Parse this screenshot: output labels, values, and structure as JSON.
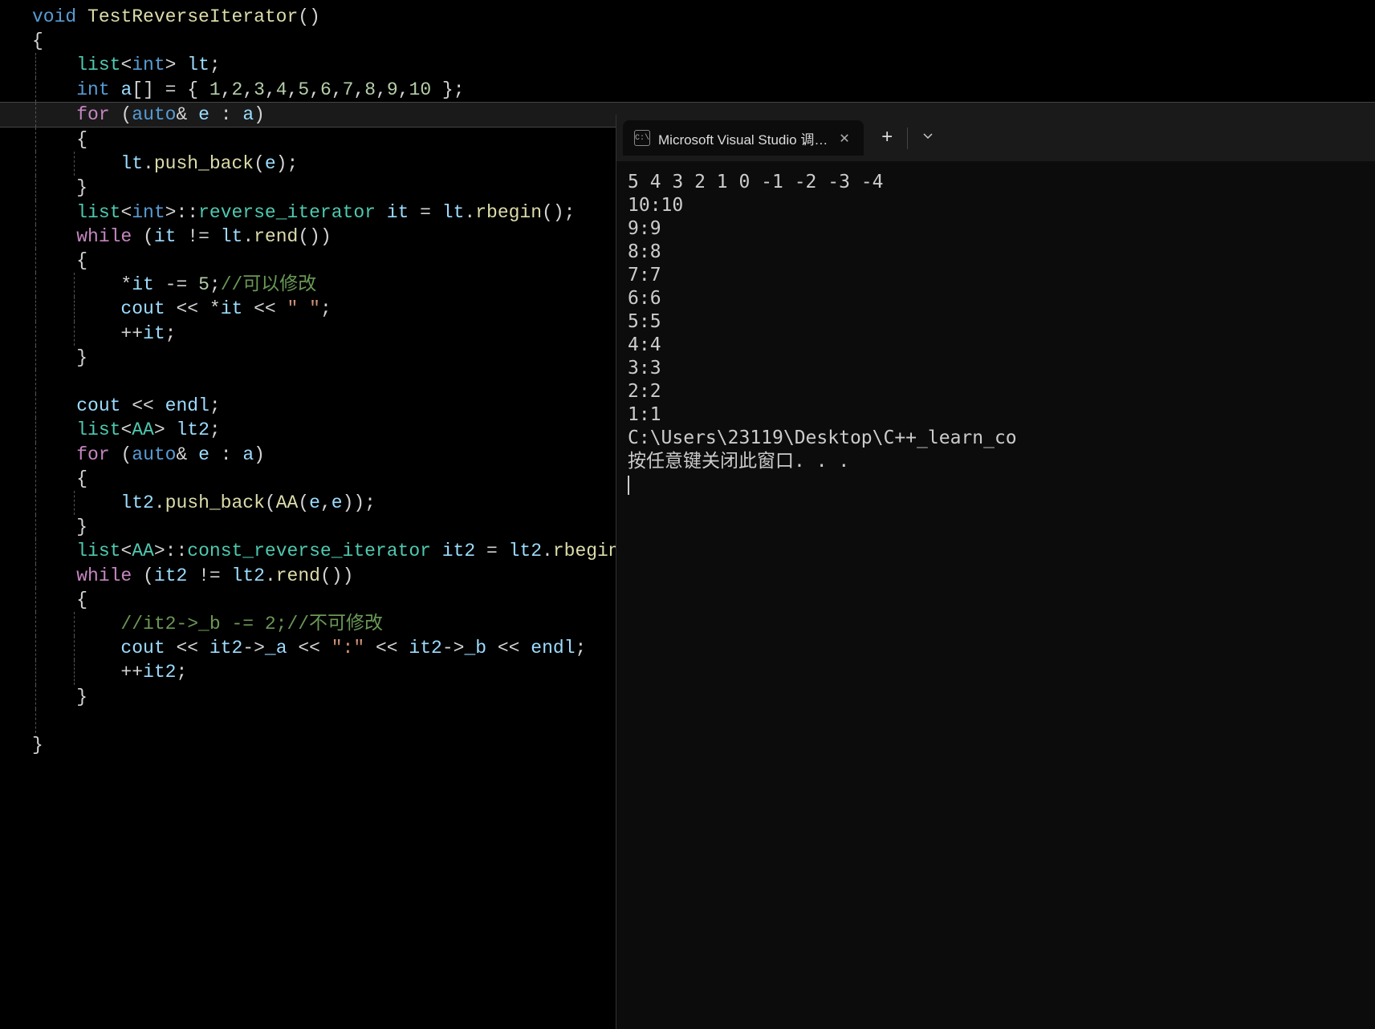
{
  "code": {
    "fn_decl": {
      "ret": "void",
      "name": "TestReverseIterator"
    },
    "l1": {
      "type": "list",
      "gen": "int",
      "var": "lt"
    },
    "l2": {
      "type": "int",
      "var": "a",
      "arr": "[]",
      "vals": [
        "1",
        "2",
        "3",
        "4",
        "5",
        "6",
        "7",
        "8",
        "9",
        "10"
      ]
    },
    "l3": {
      "for": "for",
      "auto": "auto",
      "e": "e",
      "a": "a"
    },
    "l4": {
      "obj": "lt",
      "fn": "push_back",
      "arg": "e"
    },
    "l5": {
      "type": "list",
      "gen": "int",
      "iter": "reverse_iterator",
      "var": "it",
      "rhs_obj": "lt",
      "rhs_fn": "rbegin"
    },
    "l6": {
      "while": "while",
      "it": "it",
      "obj": "lt",
      "fn": "rend"
    },
    "l7": {
      "it": "it",
      "n": "5",
      "cmt": "//可以修改"
    },
    "l8": {
      "cout": "cout",
      "it": "it",
      "sp": "\" \""
    },
    "l9": {
      "it": "it"
    },
    "l10": {
      "cout": "cout",
      "endl": "endl"
    },
    "l11": {
      "type": "list",
      "gen": "AA",
      "var": "lt2"
    },
    "l12": {
      "for": "for",
      "auto": "auto",
      "e": "e",
      "a": "a"
    },
    "l13": {
      "obj": "lt2",
      "fn": "push_back",
      "ctor": "AA",
      "a": "e",
      "b": "e"
    },
    "l14": {
      "type": "list",
      "gen": "AA",
      "iter": "const_reverse_iterator",
      "var": "it2",
      "rhs_obj": "lt2",
      "rhs_fn": "rbegin"
    },
    "l15": {
      "while": "while",
      "it": "it2",
      "obj": "lt2",
      "fn": "rend"
    },
    "l16": {
      "cmt": "//it2->_b -= 2;//不可修改"
    },
    "l17": {
      "cout": "cout",
      "it": "it2",
      "fa": "_a",
      "sep": "\":\"",
      "fb": "_b",
      "endl": "endl"
    },
    "l18": {
      "it": "it2"
    }
  },
  "terminal": {
    "tab_title": "Microsoft Visual Studio 调试控",
    "output_lines": [
      "5 4 3 2 1 0 -1 -2 -3 -4",
      "10:10",
      "9:9",
      "8:8",
      "7:7",
      "6:6",
      "5:5",
      "4:4",
      "3:3",
      "2:2",
      "1:1",
      "",
      "C:\\Users\\23119\\Desktop\\C++_learn_co",
      "按任意键关闭此窗口. . ."
    ]
  }
}
